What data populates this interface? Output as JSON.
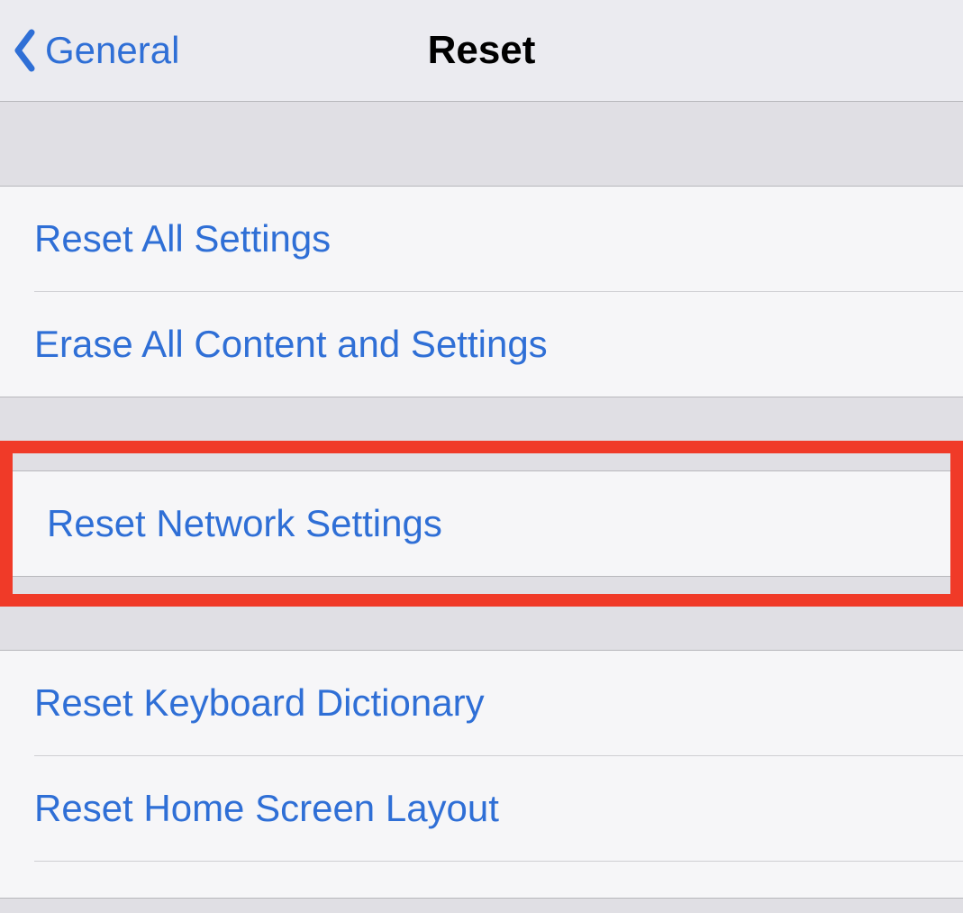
{
  "header": {
    "back_label": "General",
    "title": "Reset"
  },
  "groups": [
    {
      "rows": [
        {
          "label": "Reset All Settings"
        },
        {
          "label": "Erase All Content and Settings"
        }
      ]
    },
    {
      "highlighted": true,
      "rows": [
        {
          "label": "Reset Network Settings"
        }
      ]
    },
    {
      "rows": [
        {
          "label": "Reset Keyboard Dictionary"
        },
        {
          "label": "Reset Home Screen Layout"
        }
      ]
    }
  ]
}
